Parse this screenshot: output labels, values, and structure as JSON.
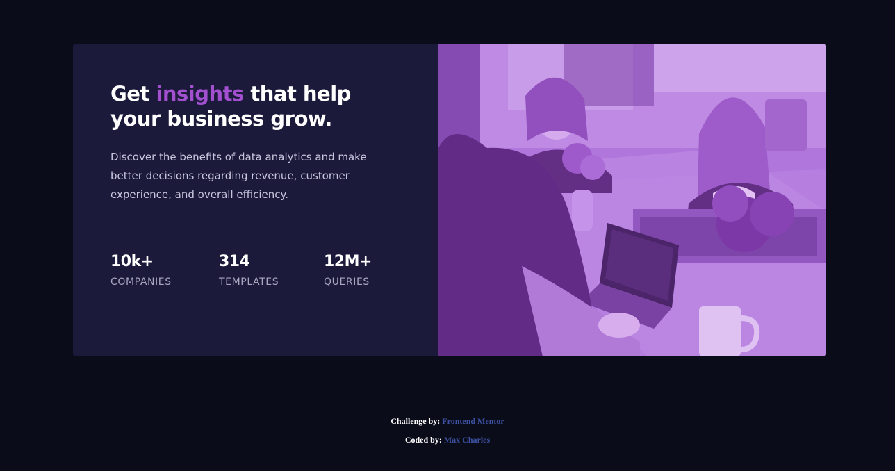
{
  "hero": {
    "title_before": "Get ",
    "title_accent": "insights",
    "title_after": " that help your business grow.",
    "description": "Discover the benefits of data analytics and make better decisions regarding revenue, customer experience, and overall efficiency.",
    "accent_color": "#a24fd0"
  },
  "stats": [
    {
      "value": "10k+",
      "label": "COMPANIES"
    },
    {
      "value": "314",
      "label": "TEMPLATES"
    },
    {
      "value": "12M+",
      "label": "QUERIES"
    }
  ],
  "image": {
    "icon": "team-at-work-photo",
    "overlay_color": "#aa5cdb"
  },
  "footer": {
    "challenge_prefix": "Challenge by:",
    "challenge_link": "Frontend Mentor",
    "coded_prefix": "Coded by:",
    "coded_link": "Max Charles",
    "link_color": "#3e52a3"
  }
}
